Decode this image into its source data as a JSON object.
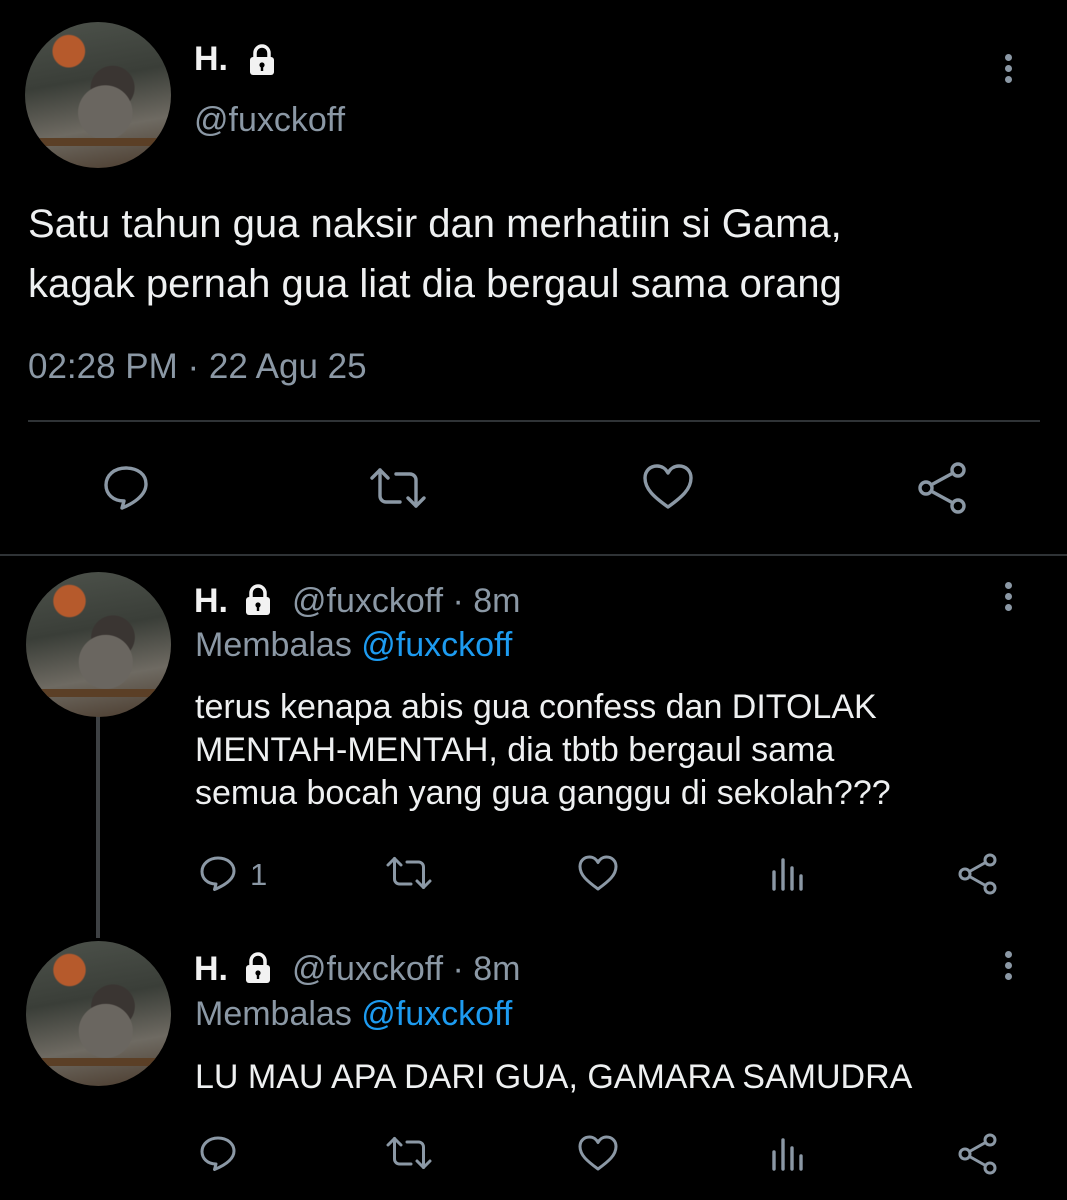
{
  "main_tweet": {
    "name": "H.",
    "handle": "@fuxckoff",
    "text_line1": "Satu tahun gua naksir dan merhatiin si Gama,",
    "text_line2": "kagak pernah gua liat dia bergaul sama orang",
    "timestamp": "02:28 PM · 22 Agu 25",
    "actions": [
      "reply-icon",
      "retweet-icon",
      "like-icon",
      "share-icon"
    ]
  },
  "replies": [
    {
      "name": "H.",
      "meta": "@fuxckoff · 8m",
      "replying_prefix": "Membalas",
      "replying_to": "@fuxckoff",
      "text_lines": [
        "terus kenapa abis gua confess dan DITOLAK",
        "MENTAH-MENTAH, dia tbtb bergaul sama",
        "semua bocah yang gua ganggu di sekolah???"
      ],
      "reply_count": "1",
      "actions": [
        "reply-icon",
        "retweet-icon",
        "like-icon",
        "views-icon",
        "share-icon"
      ]
    },
    {
      "name": "H.",
      "meta": "@fuxckoff · 8m",
      "replying_prefix": "Membalas",
      "replying_to": "@fuxckoff",
      "text_lines": [
        "LU MAU APA DARI GUA, GAMARA SAMUDRA"
      ],
      "reply_count": "",
      "actions": [
        "reply-icon",
        "retweet-icon",
        "like-icon",
        "views-icon",
        "share-icon"
      ]
    }
  ],
  "colors": {
    "background": "#000000",
    "text": "#e7e9ea",
    "secondary": "#8b98a5",
    "link": "#1d9bf0",
    "divider": "#2f3336"
  }
}
